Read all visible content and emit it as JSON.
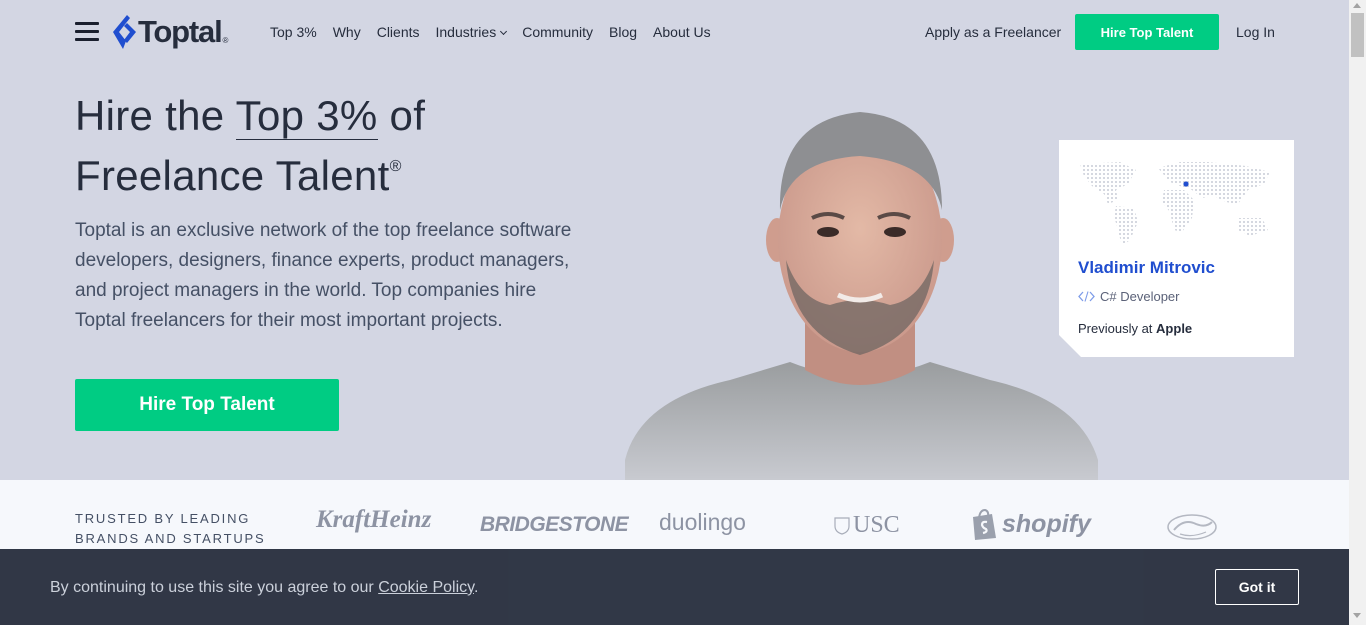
{
  "header": {
    "logo_text": "Toptal",
    "logo_reg": "®",
    "nav": [
      {
        "label": "Top 3%"
      },
      {
        "label": "Why"
      },
      {
        "label": "Clients"
      },
      {
        "label": "Industries"
      },
      {
        "label": "Community"
      },
      {
        "label": "Blog"
      },
      {
        "label": "About Us"
      }
    ],
    "apply_label": "Apply as a Freelancer",
    "hire_label": "Hire Top Talent",
    "login_label": "Log In"
  },
  "hero": {
    "headline_pre": "Hire the ",
    "headline_em": "Top 3%",
    "headline_post": " of",
    "headline_line2": "Freelance Talent",
    "headline_reg": "®",
    "description": "Toptal is an exclusive network of the top freelance software developers, designers, finance experts, product managers, and project managers in the world. Top companies hire Toptal freelancers for their most important projects.",
    "cta_label": "Hire Top Talent"
  },
  "profile_card": {
    "name": "Vladimir Mitrovic",
    "role": "C# Developer",
    "previously_prefix": "Previously at ",
    "previously_company": "Apple"
  },
  "trusted": {
    "label": "TRUSTED BY LEADING BRANDS AND STARTUPS",
    "brands": [
      "KraftHeinz",
      "BRIDGESTONE",
      "duolingo",
      "USC",
      "shopify",
      "Cavaliers"
    ]
  },
  "cookie": {
    "text_prefix": "By continuing to use this site you agree to our ",
    "link_label": "Cookie Policy",
    "text_suffix": ".",
    "button_label": "Got it"
  },
  "colors": {
    "accent_green": "#00cc83",
    "brand_blue": "#204ecf",
    "hero_bg": "#d3d6e3",
    "cookie_bg": "#262d3d"
  }
}
